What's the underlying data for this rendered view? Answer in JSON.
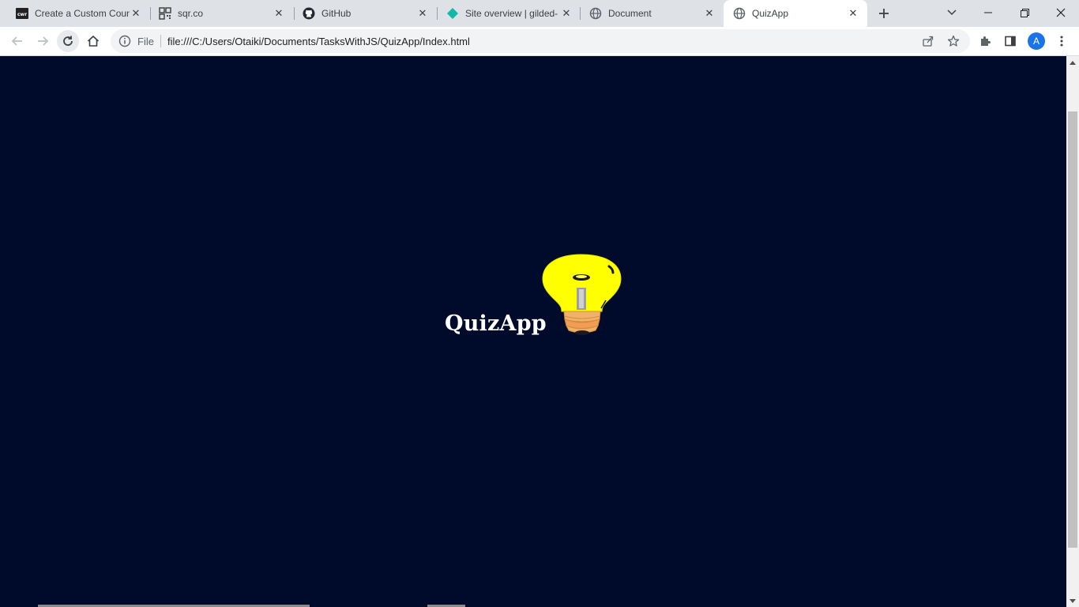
{
  "browser": {
    "tabs": [
      {
        "title": "Create a Custom Coun",
        "icon": "cwr-icon"
      },
      {
        "title": "sqr.co",
        "icon": "qr-code-icon"
      },
      {
        "title": "GitHub",
        "icon": "github-icon"
      },
      {
        "title": "Site overview | gilded-",
        "icon": "netlify-icon"
      },
      {
        "title": "Document",
        "icon": "globe-icon"
      },
      {
        "title": "QuizApp",
        "icon": "globe-icon",
        "active": true
      }
    ],
    "address": {
      "scheme_label": "File",
      "url": "file:///C:/Users/Otaiki/Documents/TasksWithJS/QuizApp/Index.html"
    },
    "profile_initial": "A",
    "colors": {
      "tabstrip_bg": "#dee1e6",
      "avatar_bg": "#1a73e8"
    }
  },
  "page": {
    "title": "QuizApp",
    "logo_icon": "lightbulb-icon",
    "background": "#000a2a"
  }
}
